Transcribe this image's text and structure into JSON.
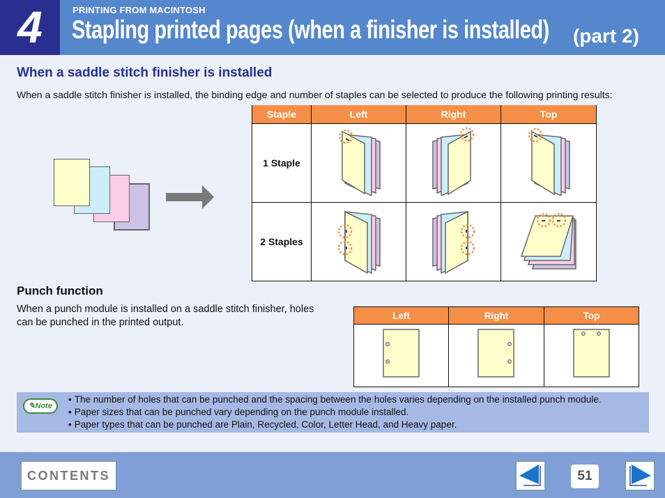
{
  "header": {
    "chapter_number": "4",
    "section_label": "PRINTING FROM MACINTOSH",
    "title": "Stapling printed pages (when a finisher is installed)",
    "part": "(part 2)"
  },
  "saddle": {
    "heading": "When a saddle stitch finisher is installed",
    "intro": "When a saddle stitch finisher is installed, the binding edge and number of staples can be selected to produce the following printing results:",
    "table": {
      "headers": [
        "Staple",
        "Left",
        "Right",
        "Top"
      ],
      "rows": [
        {
          "label": "1 Staple",
          "cells": [
            "left-1-staple-booklet",
            "right-1-staple-booklet",
            "top-1-staple-booklet"
          ]
        },
        {
          "label": "2 Staples",
          "cells": [
            "left-2-staples-booklet",
            "right-2-staples-booklet",
            "top-2-staples-pad"
          ]
        }
      ]
    },
    "sheet_colors": [
      "#ffffcc",
      "#cceefa",
      "#fbcde8",
      "#cdc3e6"
    ],
    "highlight_color": "#f58e46"
  },
  "punch": {
    "heading": "Punch function",
    "text": "When a punch module is installed on a saddle stitch finisher, holes can be punched in the printed output.",
    "table": {
      "headers": [
        "Left",
        "Right",
        "Top"
      ]
    }
  },
  "note": {
    "badge": "Note",
    "items": [
      "The number of holes that can be punched and the spacing between the holes varies depending on the installed punch module.",
      "Paper sizes that can be punched vary depending on the punch module installed.",
      "Paper types that can be punched are Plain, Recycled, Color, Letter Head, and Heavy paper."
    ]
  },
  "footer": {
    "contents_label": "CONTENTS",
    "page_number": "51"
  },
  "colors": {
    "header_bg": "#5587cd",
    "chapter_bg": "#2a2f8f",
    "table_header": "#f58e46",
    "note_bg": "#a6b9e4",
    "footer_bg": "#7f9fd6",
    "nav_arrow": "#1a73c9"
  }
}
